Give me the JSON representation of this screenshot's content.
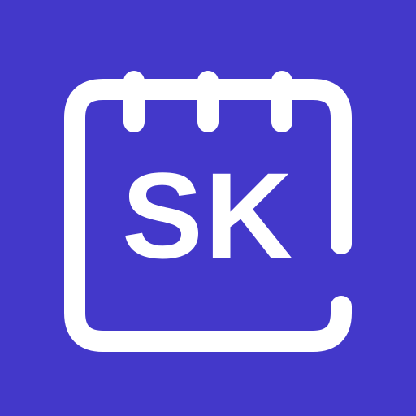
{
  "app_icon": {
    "monogram": "SK",
    "icon": "calendar-icon"
  },
  "colors": {
    "background": "#4338CA",
    "foreground": "#FFFFFF"
  }
}
